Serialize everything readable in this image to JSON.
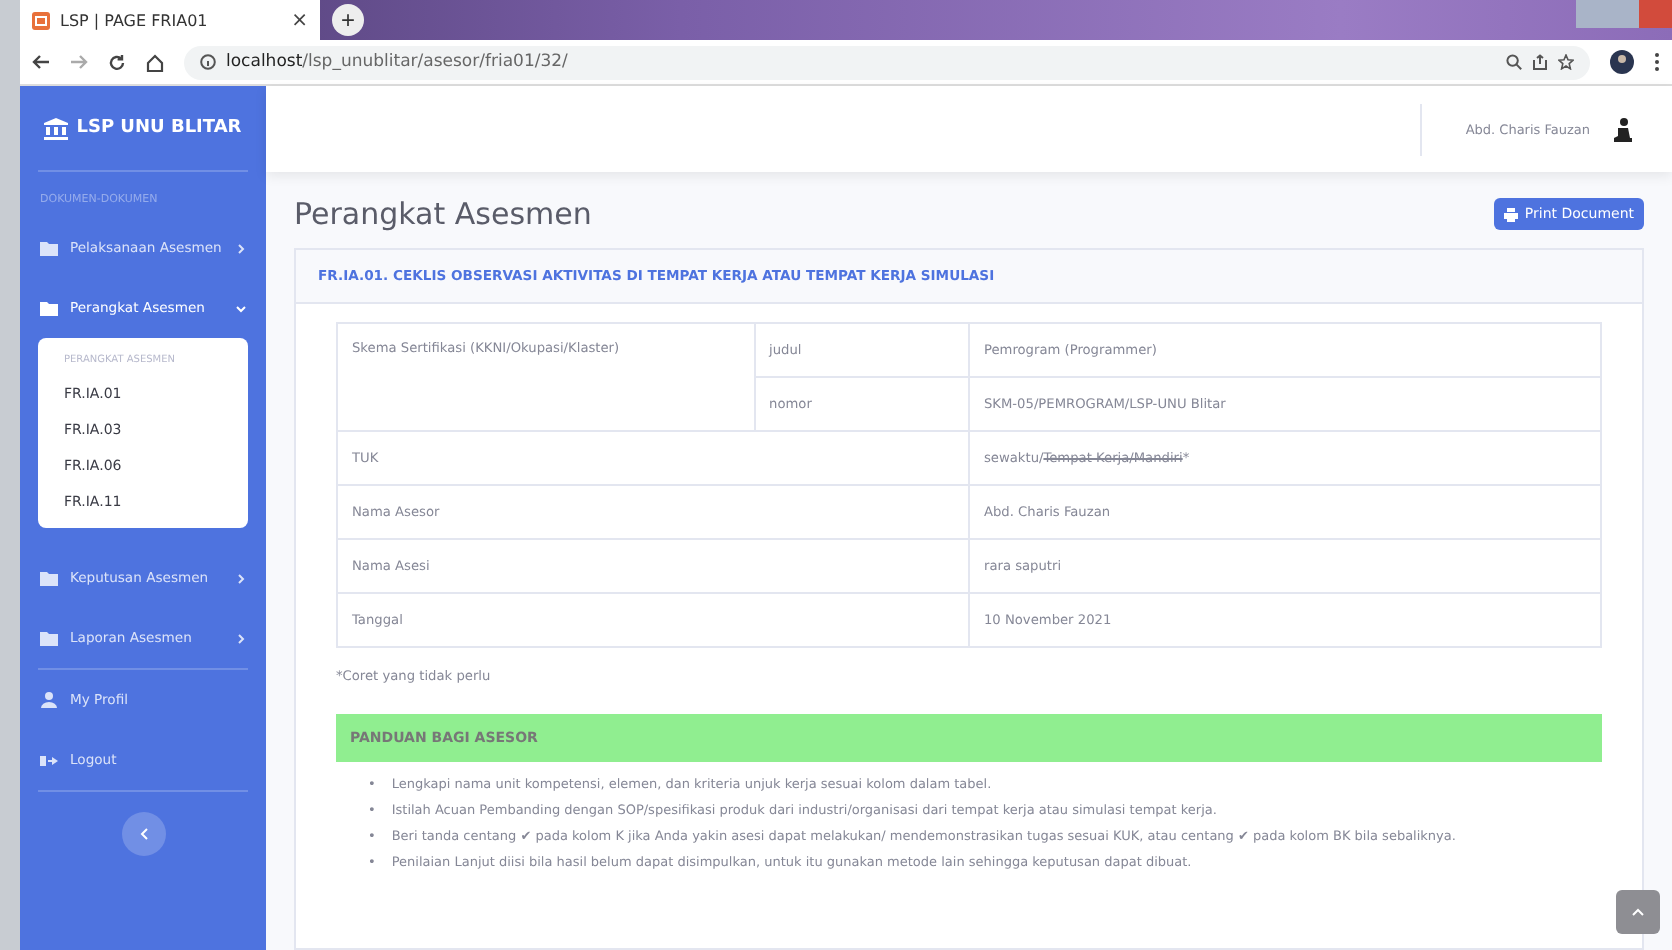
{
  "browser": {
    "tab_title": "LSP | PAGE FRIA01",
    "close": "×",
    "new_tab": "+",
    "url_host": "localhost",
    "url_path": "/lsp_unublitar/asesor/fria01/32/"
  },
  "sidebar": {
    "brand": "LSP UNU BLITAR",
    "heading": "DOKUMEN-DOKUMEN",
    "items": [
      {
        "kind": "menu",
        "label": "Pelaksanaan Asesmen",
        "expanded": false
      },
      {
        "kind": "menu",
        "label": "Perangkat Asesmen",
        "expanded": true,
        "submenu": {
          "heading": "PERANGKAT ASESMEN",
          "items": [
            {
              "label": "FR.IA.01"
            },
            {
              "label": "FR.IA.03"
            },
            {
              "label": "FR.IA.06"
            },
            {
              "label": "FR.IA.11"
            }
          ]
        }
      },
      {
        "kind": "menu",
        "label": "Keputusan Asesmen",
        "expanded": false
      },
      {
        "kind": "menu",
        "label": "Laporan Asesmen",
        "expanded": false
      },
      {
        "kind": "profile",
        "label": "My Profil"
      },
      {
        "kind": "logout",
        "label": "Logout"
      }
    ]
  },
  "topbar": {
    "user_name": "Abd. Charis Fauzan"
  },
  "page": {
    "title": "Perangkat Asesmen",
    "print_button": "Print Document"
  },
  "card": {
    "title": "FR.IA.01. CEKLIS OBSERVASI AKTIVITAS DI TEMPAT KERJA ATAU TEMPAT KERJA SIMULASI",
    "skema": {
      "label": "Skema Sertifikasi (KKNI/Okupasi/Klaster)",
      "rows": [
        {
          "field": "judul",
          "value": "Pemrogram (Programmer)"
        },
        {
          "field": "nomor",
          "value": "SKM-05/PEMROGRAM/LSP-UNU Blitar"
        }
      ]
    },
    "rows": [
      {
        "label": "TUK",
        "parts": [
          {
            "text": "sewaktu/",
            "struck": false
          },
          {
            "text": "Tempat Kerja/Mandiri",
            "struck": true
          },
          {
            "text": "*",
            "struck": false
          }
        ]
      },
      {
        "label": "Nama Asesor",
        "parts": [
          {
            "text": "Abd. Charis Fauzan",
            "struck": false
          }
        ]
      },
      {
        "label": "Nama Asesi",
        "parts": [
          {
            "text": "rara saputri",
            "struck": false
          }
        ]
      },
      {
        "label": "Tanggal",
        "parts": [
          {
            "text": "10 November 2021",
            "struck": false
          }
        ]
      }
    ],
    "note": "*Coret yang tidak perlu",
    "guide": {
      "title": "PANDUAN BAGI ASESOR",
      "items": [
        {
          "bullet": "•",
          "text": "Lengkapi nama unit kompetensi, elemen, dan kriteria unjuk kerja sesuai kolom dalam tabel."
        },
        {
          "bullet": "•",
          "text": "Istilah Acuan Pembanding dengan SOP/spesifikasi produk dari industri/organisasi dari tempat kerja atau simulasi tempat kerja."
        },
        {
          "bullet": "•",
          "text": "Beri tanda centang ✔ pada kolom K jika Anda yakin asesi dapat melakukan/ mendemonstrasikan tugas sesuai KUK, atau centang ✔ pada kolom BK bila sebaliknya."
        },
        {
          "bullet": "•",
          "text": "Penilaian Lanjut diisi bila hasil belum dapat disimpulkan, untuk itu gunakan metode lain sehingga keputusan dapat dibuat."
        }
      ]
    }
  }
}
